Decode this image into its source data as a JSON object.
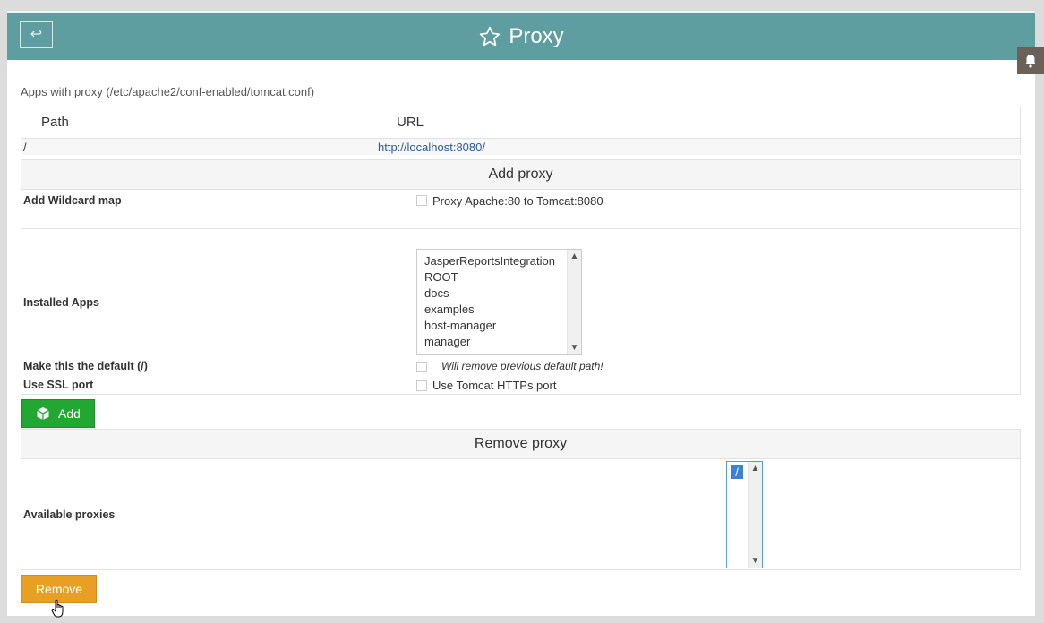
{
  "header": {
    "back_label": "↩",
    "title": "Proxy",
    "star_icon": "star-outline-icon",
    "bell_icon": "bell-icon"
  },
  "proxy_list": {
    "subtitle": "Apps with proxy (/etc/apache2/conf-enabled/tomcat.conf)",
    "columns": [
      "Path",
      "URL"
    ],
    "rows": [
      {
        "path": "/",
        "url": "http://localhost:8080/"
      }
    ]
  },
  "add_proxy": {
    "heading": "Add proxy",
    "wildcard_label": "Add Wildcard map",
    "wildcard_checkbox_text": "Proxy Apache:80 to Tomcat:8080",
    "installed_apps_label": "Installed Apps",
    "installed_apps": [
      "JasperReportsIntegration",
      "ROOT",
      "docs",
      "examples",
      "host-manager",
      "manager"
    ],
    "default_label": "Make this the default (/)",
    "default_note": "Will remove previous default path!",
    "ssl_label": "Use SSL port",
    "ssl_checkbox_text": "Use Tomcat HTTPs port",
    "add_button": "Add"
  },
  "remove_proxy": {
    "heading": "Remove proxy",
    "available_label": "Available proxies",
    "available_proxies": [
      "/"
    ],
    "selected": "/",
    "remove_button": "Remove"
  },
  "colors": {
    "header_bg": "#5f9ea0",
    "add_button": "#22a832",
    "remove_button": "#e8a024",
    "link": "#2a5a9a"
  }
}
